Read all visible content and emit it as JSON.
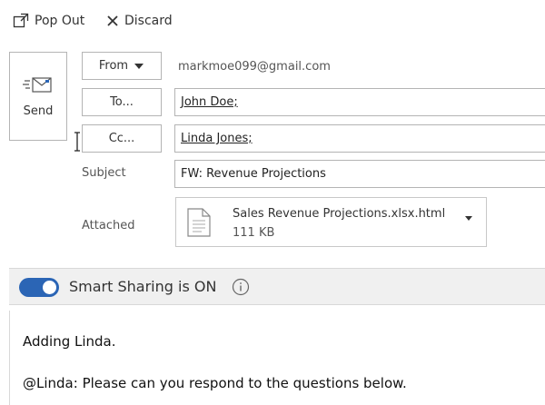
{
  "toolbar": {
    "popout_label": "Pop Out",
    "discard_label": "Discard"
  },
  "compose": {
    "send_label": "Send",
    "from_label": "From",
    "from_address": "markmoe099@gmail.com",
    "to_label": "To...",
    "to_value": "John Doe;",
    "cc_label": "Cc...",
    "cc_value": "Linda Jones;",
    "subject_label": "Subject",
    "subject_value": "FW: Revenue Projections",
    "attached_label": "Attached",
    "attachment": {
      "name": "Sales Revenue Projections.xlsx.html",
      "size": "111 KB"
    }
  },
  "smart_sharing": {
    "text": "Smart Sharing is ON",
    "enabled": true,
    "accent": "#2b65b5"
  },
  "body": {
    "line1": "Adding Linda.",
    "line2": "@Linda: Please can you respond to the questions below."
  }
}
